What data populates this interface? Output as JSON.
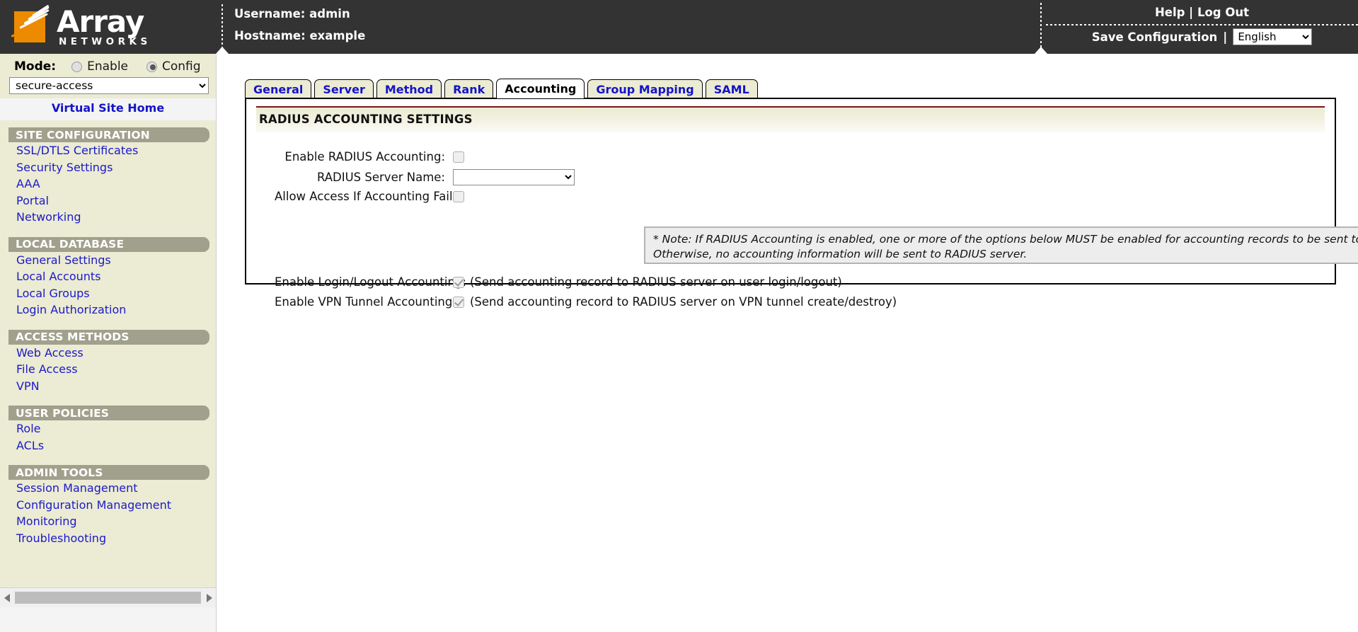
{
  "header": {
    "logo_primary": "Array",
    "logo_secondary": "NETWORKS",
    "username_line": "Username: admin",
    "hostname_line": "Hostname: example",
    "help_label": "Help",
    "separator": "|",
    "logout_label": "Log Out",
    "save_config_label": "Save Configuration",
    "language_selected": "English",
    "language_options": [
      "English"
    ]
  },
  "sidebar": {
    "mode_label": "Mode:",
    "mode_enable_label": "Enable",
    "mode_config_label": "Config",
    "mode_selected": "Config",
    "site_selected": "secure-access",
    "site_options": [
      "secure-access"
    ],
    "virtual_site_home": "Virtual Site Home",
    "sections": [
      {
        "title": "SITE CONFIGURATION",
        "items": [
          "SSL/DTLS Certificates",
          "Security Settings",
          "AAA",
          "Portal",
          "Networking"
        ]
      },
      {
        "title": "LOCAL DATABASE",
        "items": [
          "General Settings",
          "Local Accounts",
          "Local Groups",
          "Login Authorization"
        ]
      },
      {
        "title": "ACCESS METHODS",
        "items": [
          "Web Access",
          "File Access",
          "VPN"
        ]
      },
      {
        "title": "USER POLICIES",
        "items": [
          "Role",
          "ACLs"
        ]
      },
      {
        "title": "ADMIN TOOLS",
        "items": [
          "Session Management",
          "Configuration Management",
          "Monitoring",
          "Troubleshooting"
        ]
      }
    ]
  },
  "tabs": [
    {
      "label": "General",
      "active": false
    },
    {
      "label": "Server",
      "active": false
    },
    {
      "label": "Method",
      "active": false
    },
    {
      "label": "Rank",
      "active": false
    },
    {
      "label": "Accounting",
      "active": true
    },
    {
      "label": "Group Mapping",
      "active": false
    },
    {
      "label": "SAML",
      "active": false
    }
  ],
  "panel": {
    "title": "RADIUS ACCOUNTING SETTINGS",
    "fields": {
      "enable_radius_accounting_label": "Enable RADIUS Accounting:",
      "enable_radius_accounting_checked": false,
      "radius_server_name_label": "RADIUS Server Name:",
      "radius_server_name_value": "",
      "radius_server_name_options": [
        ""
      ],
      "allow_access_if_fails_label": "Allow Access If Accounting Fails:",
      "allow_access_if_fails_checked": false,
      "enable_login_logout_label": "Enable Login/Logout Accounting:",
      "enable_login_logout_checked": true,
      "enable_login_logout_hint": "(Send accounting record to RADIUS server on user login/logout)",
      "enable_vpn_tunnel_label": "Enable VPN Tunnel Accounting:",
      "enable_vpn_tunnel_checked": true,
      "enable_vpn_tunnel_hint": "(Send accounting record to RADIUS server on VPN tunnel create/destroy)"
    },
    "note": "* Note: If RADIUS Accounting is enabled, one or more of the options below MUST be enabled for accounting records to be sent to RADIUS server.  Otherwise, no accounting information will be sent to RADIUS server."
  },
  "colors": {
    "banner_bg": "#333333",
    "logo_orange": "#ED8B00",
    "sidebar_bg": "#ecebd4",
    "section_header_bg": "#a0a08c",
    "link_blue": "#1a1ac8",
    "panel_accent": "#7c1414",
    "note_bg": "#ededed"
  }
}
